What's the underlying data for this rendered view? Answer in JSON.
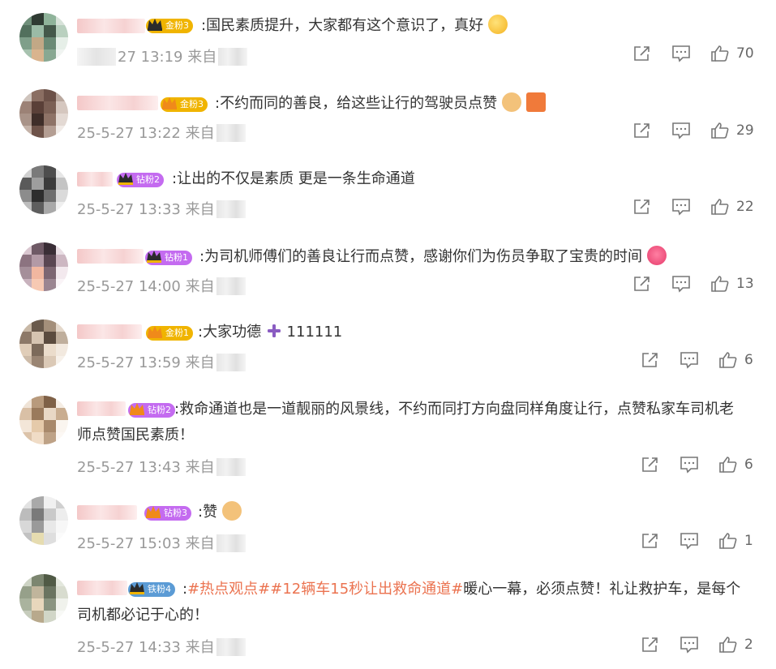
{
  "comments": [
    {
      "id": 1,
      "badge": "金粉3",
      "badge_color": "#f0b400",
      "segments": [
        {
          "t": ":国民素质提升，大家都有这个意识了，真好",
          "hl": false
        }
      ],
      "emoji": "666-face",
      "time_prefix": "27 13:19",
      "source": "来自",
      "likes": "70"
    },
    {
      "id": 2,
      "badge": "金粉3",
      "badge_color": "#f0b400",
      "segments": [
        {
          "t": ":不约而同的善良，给这些让行的驾驶员点赞",
          "hl": false
        }
      ],
      "emoji": "thumbs-up + 赞",
      "time": "25-5-27 13:22",
      "source": "来自",
      "likes": "29"
    },
    {
      "id": 3,
      "badge": "钻粉2",
      "badge_color": "#c46bf0",
      "segments": [
        {
          "t": ":让出的不仅是素质 更是一条生命通道",
          "hl": false
        }
      ],
      "time": "25-5-27 13:33",
      "source": "来自",
      "likes": "22"
    },
    {
      "id": 4,
      "badge": "钻粉1",
      "badge_color": "#c46bf0",
      "segments": [
        {
          "t": ":为司机师傅们的善良让行而点赞，感谢你们为伤员争取了宝贵的时间",
          "hl": false
        }
      ],
      "emoji": "heart",
      "time": "25-5-27 14:00",
      "source": "来自",
      "likes": "13"
    },
    {
      "id": 5,
      "badge": "金粉1",
      "badge_color": "#f0b400",
      "segments": [
        {
          "t": ":大家功德",
          "hl": false
        },
        {
          "t": "111111",
          "hl": false
        }
      ],
      "emoji": "plus",
      "time": "25-5-27 13:59",
      "source": "来自",
      "likes": "6"
    },
    {
      "id": 6,
      "badge": "钻粉2",
      "badge_color": "#c46bf0",
      "segments": [
        {
          "t": ":救命通道也是一道靓丽的风景线，不约而同打方向盘同样角度让行，点赞私家车司机老师点赞国民素质！",
          "hl": false
        }
      ],
      "time": "25-5-27 13:43",
      "source": "来自",
      "likes": "6"
    },
    {
      "id": 7,
      "badge": "钻粉3",
      "badge_color": "#c46bf0",
      "segments": [
        {
          "t": ":赞",
          "hl": false
        }
      ],
      "emoji": "thumbs-up",
      "time": "25-5-27 15:03",
      "source": "来自",
      "likes": "1"
    },
    {
      "id": 8,
      "badge": "铁粉4",
      "badge_color": "#5b9bd5",
      "segments": [
        {
          "t": ":",
          "hl": false
        },
        {
          "t": "#热点观点#",
          "hl": true
        },
        {
          "t": "#12辆车15秒让出救命通道#",
          "hl": true
        },
        {
          "t": "暖心一幕，必须点赞！礼让救护车，是每个司机都必记于心的！",
          "hl": false
        }
      ],
      "time": "25-5-27 14:33",
      "source": "来自",
      "likes": "2"
    }
  ]
}
